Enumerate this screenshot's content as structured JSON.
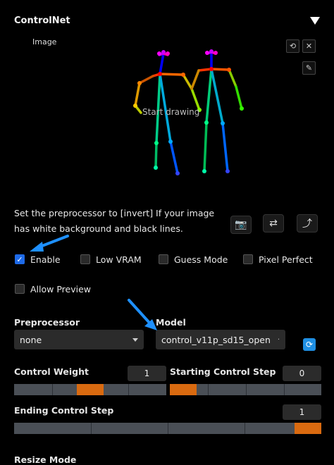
{
  "panel": {
    "title": "ControlNet",
    "image_label": "Image",
    "canvas_placeholder": "Start drawing"
  },
  "canvas_tools": {
    "reset": "⟲",
    "close": "✕",
    "edit": "✎"
  },
  "hint_text": "Set the preprocessor to [invert] If your image has white background and black lines.",
  "side_buttons": {
    "camera": "📷",
    "swap": "⇄",
    "send": "⤴"
  },
  "checkboxes": {
    "enable": {
      "label": "Enable",
      "checked": true
    },
    "low_vram": {
      "label": "Low VRAM",
      "checked": false
    },
    "guess_mode": {
      "label": "Guess Mode",
      "checked": false
    },
    "pixel_perfect": {
      "label": "Pixel Perfect",
      "checked": false
    },
    "allow_preview": {
      "label": "Allow Preview",
      "checked": false
    }
  },
  "preprocessor": {
    "label": "Preprocessor",
    "value": "none"
  },
  "model": {
    "label": "Model",
    "value": "control_v11p_sd15_open"
  },
  "control_weight": {
    "label": "Control Weight",
    "value": "1",
    "fraction": 0.5
  },
  "starting_step": {
    "label": "Starting Control Step",
    "value": "0",
    "fraction": 0.0
  },
  "ending_step": {
    "label": "Ending Control Step",
    "value": "1",
    "fraction": 1.0
  },
  "resize_mode": {
    "label": "Resize Mode"
  },
  "colors": {
    "accent": "#1e6ae8",
    "slider_thumb": "#d96a10",
    "arrow": "#1e90ff"
  }
}
